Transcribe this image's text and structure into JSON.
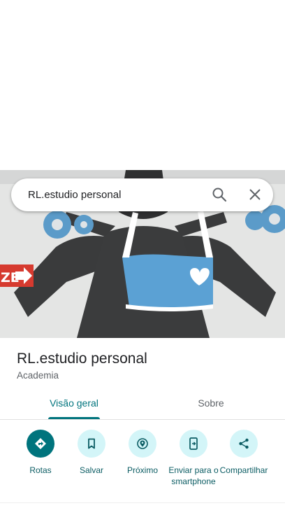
{
  "search": {
    "query": "RL.estudio personal"
  },
  "hero": {
    "sign_text": "ZE"
  },
  "place": {
    "name": "RL.estudio personal",
    "category": "Academia"
  },
  "tabs": [
    {
      "label": "Visão geral",
      "active": true
    },
    {
      "label": "Sobre",
      "active": false
    }
  ],
  "actions": [
    {
      "label": "Rotas",
      "icon": "directions-icon"
    },
    {
      "label": "Salvar",
      "icon": "bookmark-icon"
    },
    {
      "label": "Próximo",
      "icon": "nearby-icon"
    },
    {
      "label": "Enviar para o smartphone",
      "icon": "send-to-phone-icon"
    },
    {
      "label": "Compartilhar",
      "icon": "share-icon"
    }
  ],
  "colors": {
    "accent": "#00747d",
    "action_bg": "#d3f5f8",
    "label": "#0b5c63"
  }
}
